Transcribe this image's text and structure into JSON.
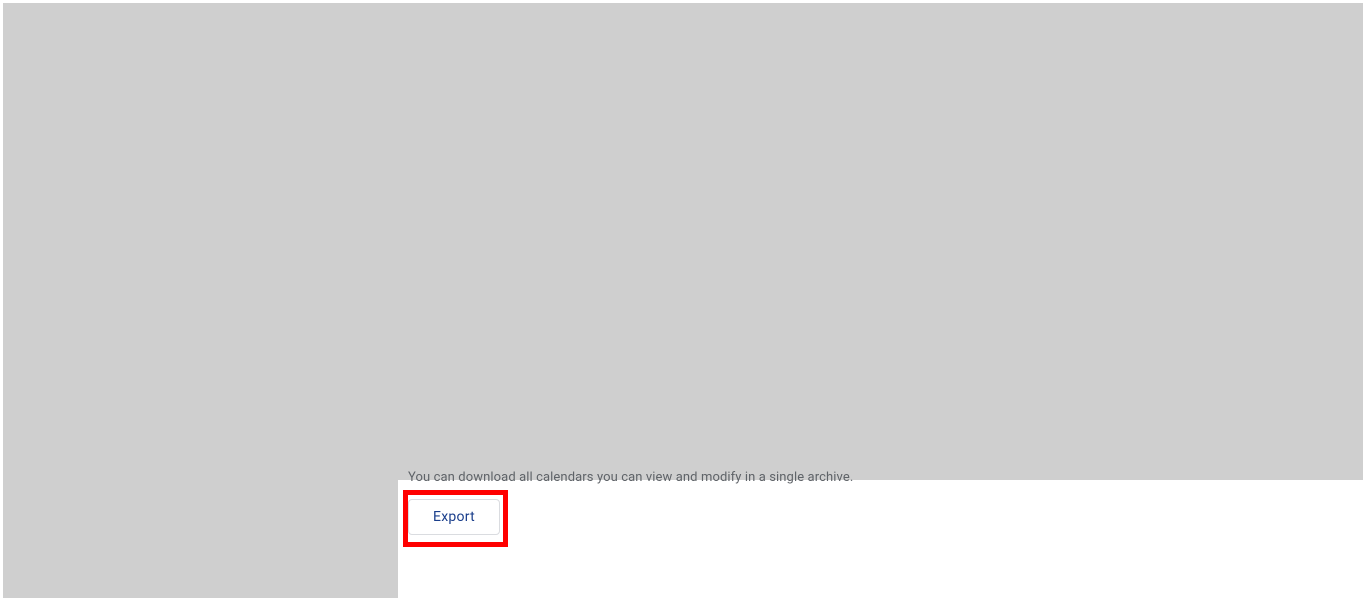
{
  "export_section": {
    "description": "You can download all calendars you can view and modify in a single archive.",
    "button_label": "Export"
  }
}
